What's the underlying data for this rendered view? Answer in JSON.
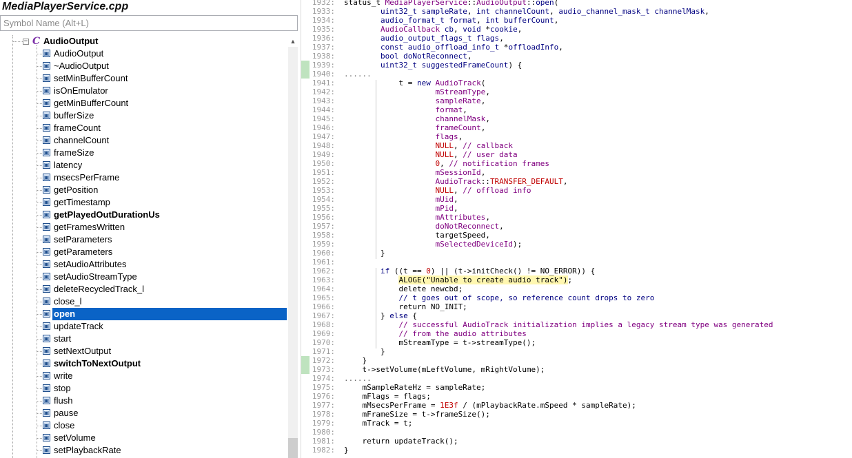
{
  "file": {
    "title": "MediaPlayerService.cpp"
  },
  "search": {
    "placeholder": "Symbol Name (Alt+L)"
  },
  "tree": {
    "class_name": "AudioOutput",
    "expander_glyph": "−",
    "class_icon_glyph": "C",
    "method_icon_glyph": "▣",
    "methods": [
      {
        "label": "AudioOutput",
        "bold": false,
        "selected": false
      },
      {
        "label": "~AudioOutput",
        "bold": false,
        "selected": false
      },
      {
        "label": "setMinBufferCount",
        "bold": false,
        "selected": false
      },
      {
        "label": "isOnEmulator",
        "bold": false,
        "selected": false
      },
      {
        "label": "getMinBufferCount",
        "bold": false,
        "selected": false
      },
      {
        "label": "bufferSize",
        "bold": false,
        "selected": false
      },
      {
        "label": "frameCount",
        "bold": false,
        "selected": false
      },
      {
        "label": "channelCount",
        "bold": false,
        "selected": false
      },
      {
        "label": "frameSize",
        "bold": false,
        "selected": false
      },
      {
        "label": "latency",
        "bold": false,
        "selected": false
      },
      {
        "label": "msecsPerFrame",
        "bold": false,
        "selected": false
      },
      {
        "label": "getPosition",
        "bold": false,
        "selected": false
      },
      {
        "label": "getTimestamp",
        "bold": false,
        "selected": false
      },
      {
        "label": "getPlayedOutDurationUs",
        "bold": true,
        "selected": false
      },
      {
        "label": "getFramesWritten",
        "bold": false,
        "selected": false
      },
      {
        "label": "setParameters",
        "bold": false,
        "selected": false
      },
      {
        "label": "getParameters",
        "bold": false,
        "selected": false
      },
      {
        "label": "setAudioAttributes",
        "bold": false,
        "selected": false
      },
      {
        "label": "setAudioStreamType",
        "bold": false,
        "selected": false
      },
      {
        "label": "deleteRecycledTrack_l",
        "bold": false,
        "selected": false
      },
      {
        "label": "close_l",
        "bold": false,
        "selected": false
      },
      {
        "label": "open",
        "bold": true,
        "selected": true
      },
      {
        "label": "updateTrack",
        "bold": false,
        "selected": false
      },
      {
        "label": "start",
        "bold": false,
        "selected": false
      },
      {
        "label": "setNextOutput",
        "bold": false,
        "selected": false
      },
      {
        "label": "switchToNextOutput",
        "bold": true,
        "selected": false
      },
      {
        "label": "write",
        "bold": false,
        "selected": false
      },
      {
        "label": "stop",
        "bold": false,
        "selected": false
      },
      {
        "label": "flush",
        "bold": false,
        "selected": false
      },
      {
        "label": "pause",
        "bold": false,
        "selected": false
      },
      {
        "label": "close",
        "bold": false,
        "selected": false
      },
      {
        "label": "setVolume",
        "bold": false,
        "selected": false
      },
      {
        "label": "setPlaybackRate",
        "bold": false,
        "selected": false
      }
    ]
  },
  "scrollbar": {
    "up_glyph": "▲"
  },
  "editor": {
    "fold_marker": "......",
    "lines": [
      {
        "ln": "1932:",
        "segs": [
          [
            "status_t ",
            ""
          ],
          [
            "MediaPlayerService",
            "id"
          ],
          [
            "::",
            ""
          ],
          [
            "AudioOutput",
            "id"
          ],
          [
            "::",
            ""
          ],
          [
            "open",
            "kw"
          ],
          [
            "(",
            ""
          ]
        ]
      },
      {
        "ln": "1933:",
        "segs": [
          [
            "        ",
            ""
          ],
          [
            "uint32_t",
            "ty"
          ],
          [
            " ",
            ""
          ],
          [
            "sampleRate",
            "kw"
          ],
          [
            ", ",
            ""
          ],
          [
            "int",
            "ty"
          ],
          [
            " ",
            ""
          ],
          [
            "channelCount",
            "kw"
          ],
          [
            ", ",
            ""
          ],
          [
            "audio_channel_mask_t",
            "ty"
          ],
          [
            " ",
            ""
          ],
          [
            "channelMask",
            "kw"
          ],
          [
            ",",
            ""
          ]
        ]
      },
      {
        "ln": "1934:",
        "segs": [
          [
            "        ",
            ""
          ],
          [
            "audio_format_t",
            "ty"
          ],
          [
            " ",
            ""
          ],
          [
            "format",
            "kw"
          ],
          [
            ", ",
            ""
          ],
          [
            "int",
            "ty"
          ],
          [
            " ",
            ""
          ],
          [
            "bufferCount",
            "kw"
          ],
          [
            ",",
            ""
          ]
        ]
      },
      {
        "ln": "1935:",
        "segs": [
          [
            "        ",
            ""
          ],
          [
            "AudioCallback",
            "id"
          ],
          [
            " ",
            ""
          ],
          [
            "cb",
            "kw"
          ],
          [
            ", ",
            ""
          ],
          [
            "void",
            "ty"
          ],
          [
            " *",
            ""
          ],
          [
            "cookie",
            "kw"
          ],
          [
            ",",
            ""
          ]
        ]
      },
      {
        "ln": "1936:",
        "segs": [
          [
            "        ",
            ""
          ],
          [
            "audio_output_flags_t",
            "ty"
          ],
          [
            " ",
            ""
          ],
          [
            "flags",
            "kw"
          ],
          [
            ",",
            ""
          ]
        ]
      },
      {
        "ln": "1937:",
        "segs": [
          [
            "        ",
            ""
          ],
          [
            "const",
            "ty"
          ],
          [
            " ",
            ""
          ],
          [
            "audio_offload_info_t",
            "ty"
          ],
          [
            " *",
            ""
          ],
          [
            "offloadInfo",
            "kw"
          ],
          [
            ",",
            ""
          ]
        ]
      },
      {
        "ln": "1938:",
        "segs": [
          [
            "        ",
            ""
          ],
          [
            "bool",
            "ty"
          ],
          [
            " ",
            ""
          ],
          [
            "doNotReconnect",
            "kw"
          ],
          [
            ",",
            ""
          ]
        ]
      },
      {
        "ln": "1939:",
        "segs": [
          [
            "        ",
            ""
          ],
          [
            "uint32_t",
            "ty"
          ],
          [
            " ",
            ""
          ],
          [
            "suggestedFrameCount",
            "kw"
          ],
          [
            ") {",
            ""
          ]
        ]
      },
      {
        "ln": "1940:",
        "fold": true,
        "segs": []
      },
      {
        "ln": "1941:",
        "segs": [
          [
            "            t = ",
            ""
          ],
          [
            "new",
            "kw"
          ],
          [
            " ",
            ""
          ],
          [
            "AudioTrack",
            "id"
          ],
          [
            "(",
            ""
          ]
        ]
      },
      {
        "ln": "1942:",
        "segs": [
          [
            "                    ",
            ""
          ],
          [
            "mStreamType",
            "id"
          ],
          [
            ",",
            ""
          ]
        ]
      },
      {
        "ln": "1943:",
        "segs": [
          [
            "                    ",
            ""
          ],
          [
            "sampleRate",
            "id"
          ],
          [
            ",",
            ""
          ]
        ]
      },
      {
        "ln": "1944:",
        "segs": [
          [
            "                    ",
            ""
          ],
          [
            "format",
            "id"
          ],
          [
            ",",
            ""
          ]
        ]
      },
      {
        "ln": "1945:",
        "segs": [
          [
            "                    ",
            ""
          ],
          [
            "channelMask",
            "id"
          ],
          [
            ",",
            ""
          ]
        ]
      },
      {
        "ln": "1946:",
        "segs": [
          [
            "                    ",
            ""
          ],
          [
            "frameCount",
            "id"
          ],
          [
            ",",
            ""
          ]
        ]
      },
      {
        "ln": "1947:",
        "segs": [
          [
            "                    ",
            ""
          ],
          [
            "flags",
            "id"
          ],
          [
            ",",
            ""
          ]
        ]
      },
      {
        "ln": "1948:",
        "segs": [
          [
            "                    ",
            ""
          ],
          [
            "NULL",
            "mac"
          ],
          [
            ", ",
            ""
          ],
          [
            "// callback",
            "id"
          ]
        ]
      },
      {
        "ln": "1949:",
        "segs": [
          [
            "                    ",
            ""
          ],
          [
            "NULL",
            "mac"
          ],
          [
            ", ",
            ""
          ],
          [
            "// user data",
            "id"
          ]
        ]
      },
      {
        "ln": "1950:",
        "segs": [
          [
            "                    ",
            ""
          ],
          [
            "0",
            "num"
          ],
          [
            ", ",
            ""
          ],
          [
            "// notification frames",
            "id"
          ]
        ]
      },
      {
        "ln": "1951:",
        "segs": [
          [
            "                    ",
            ""
          ],
          [
            "mSessionId",
            "id"
          ],
          [
            ",",
            ""
          ]
        ]
      },
      {
        "ln": "1952:",
        "segs": [
          [
            "                    ",
            ""
          ],
          [
            "AudioTrack",
            "id"
          ],
          [
            "::",
            ""
          ],
          [
            "TRANSFER_DEFAULT",
            "mac"
          ],
          [
            ",",
            ""
          ]
        ]
      },
      {
        "ln": "1953:",
        "segs": [
          [
            "                    ",
            ""
          ],
          [
            "NULL",
            "mac"
          ],
          [
            ", ",
            ""
          ],
          [
            "// offload info",
            "id"
          ]
        ]
      },
      {
        "ln": "1954:",
        "segs": [
          [
            "                    ",
            ""
          ],
          [
            "mUid",
            "id"
          ],
          [
            ",",
            ""
          ]
        ]
      },
      {
        "ln": "1955:",
        "segs": [
          [
            "                    ",
            ""
          ],
          [
            "mPid",
            "id"
          ],
          [
            ",",
            ""
          ]
        ]
      },
      {
        "ln": "1956:",
        "segs": [
          [
            "                    ",
            ""
          ],
          [
            "mAttributes",
            "id"
          ],
          [
            ",",
            ""
          ]
        ]
      },
      {
        "ln": "1957:",
        "segs": [
          [
            "                    ",
            ""
          ],
          [
            "doNotReconnect",
            "id"
          ],
          [
            ",",
            ""
          ]
        ]
      },
      {
        "ln": "1958:",
        "segs": [
          [
            "                    targetSpeed,",
            ""
          ]
        ]
      },
      {
        "ln": "1959:",
        "segs": [
          [
            "                    ",
            ""
          ],
          [
            "mSelectedDeviceId",
            "id"
          ],
          [
            ");",
            ""
          ]
        ]
      },
      {
        "ln": "1960:",
        "segs": [
          [
            "        }",
            ""
          ]
        ]
      },
      {
        "ln": "1961:",
        "segs": []
      },
      {
        "ln": "1962:",
        "segs": [
          [
            "        ",
            ""
          ],
          [
            "if",
            "kw"
          ],
          [
            " ((t == ",
            ""
          ],
          [
            "0",
            "num"
          ],
          [
            ") || (t->initCheck() != NO_ERROR)) {",
            ""
          ]
        ]
      },
      {
        "ln": "1963:",
        "segs": [
          [
            "            ",
            ""
          ],
          [
            "ALOGE(\"Unable to create audio track\")",
            "hl"
          ],
          [
            ";",
            ""
          ]
        ]
      },
      {
        "ln": "1964:",
        "segs": [
          [
            "            delete newcbd;",
            ""
          ]
        ]
      },
      {
        "ln": "1965:",
        "segs": [
          [
            "            ",
            ""
          ],
          [
            "// t goes out of scope, so reference count drops to zero",
            "kw"
          ]
        ]
      },
      {
        "ln": "1966:",
        "segs": [
          [
            "            return NO_INIT;",
            ""
          ]
        ]
      },
      {
        "ln": "1967:",
        "segs": [
          [
            "        } ",
            ""
          ],
          [
            "else",
            "kw"
          ],
          [
            " {",
            ""
          ]
        ]
      },
      {
        "ln": "1968:",
        "segs": [
          [
            "            ",
            ""
          ],
          [
            "// successful AudioTrack initialization implies a legacy stream type was generated",
            "id"
          ]
        ]
      },
      {
        "ln": "1969:",
        "segs": [
          [
            "            ",
            ""
          ],
          [
            "// from the audio attributes",
            "id"
          ]
        ]
      },
      {
        "ln": "1970:",
        "segs": [
          [
            "            mStreamType = t->streamType();",
            ""
          ]
        ]
      },
      {
        "ln": "1971:",
        "segs": [
          [
            "        }",
            ""
          ]
        ]
      },
      {
        "ln": "1972:",
        "segs": [
          [
            "    }",
            ""
          ]
        ]
      },
      {
        "ln": "1973:",
        "segs": [
          [
            "    t->setVolume(mLeftVolume, mRightVolume);",
            ""
          ]
        ]
      },
      {
        "ln": "1974:",
        "fold": true,
        "segs": []
      },
      {
        "ln": "1975:",
        "segs": [
          [
            "    mSampleRateHz = sampleRate;",
            ""
          ]
        ]
      },
      {
        "ln": "1976:",
        "segs": [
          [
            "    mFlags = flags;",
            ""
          ]
        ]
      },
      {
        "ln": "1977:",
        "segs": [
          [
            "    mMsecsPerFrame = ",
            ""
          ],
          [
            "1E3f",
            "num"
          ],
          [
            " / (mPlaybackRate.mSpeed * sampleRate);",
            ""
          ]
        ]
      },
      {
        "ln": "1978:",
        "segs": [
          [
            "    mFrameSize = t->frameSize();",
            ""
          ]
        ]
      },
      {
        "ln": "1979:",
        "segs": [
          [
            "    mTrack = t;",
            ""
          ]
        ]
      },
      {
        "ln": "1980:",
        "segs": []
      },
      {
        "ln": "1981:",
        "segs": [
          [
            "    return updateTrack();",
            ""
          ]
        ]
      },
      {
        "ln": "1982:",
        "segs": [
          [
            "}",
            ""
          ]
        ]
      }
    ]
  }
}
